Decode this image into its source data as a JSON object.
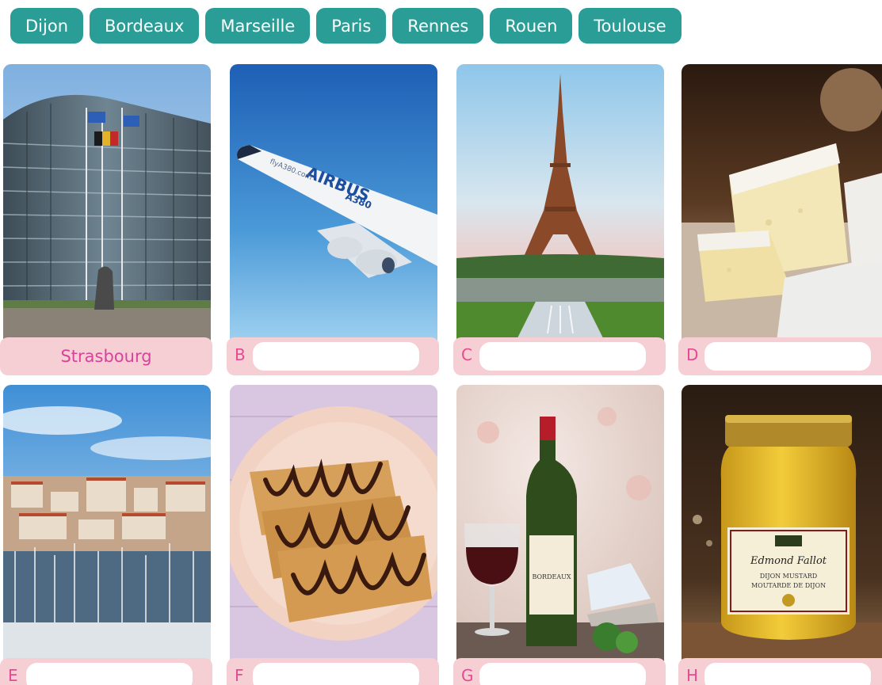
{
  "word_bank": [
    "Dijon",
    "Bordeaux",
    "Marseille",
    "Paris",
    "Rennes",
    "Rouen",
    "Toulouse"
  ],
  "cards": [
    {
      "letter": "",
      "answer": "Strasbourg"
    },
    {
      "letter": "B",
      "answer": ""
    },
    {
      "letter": "C",
      "answer": ""
    },
    {
      "letter": "D",
      "answer": ""
    },
    {
      "letter": "E",
      "answer": ""
    },
    {
      "letter": "F",
      "answer": ""
    },
    {
      "letter": "G",
      "answer": ""
    },
    {
      "letter": "H",
      "answer": ""
    }
  ],
  "photo_text": {
    "airbus": "AIRBUS",
    "a380": "A380",
    "fly": "flyA380.com",
    "jar_brand": "Edmond Fallot",
    "jar_line1": "DIJON MUSTARD",
    "jar_line2": "MOUTARDE DE DIJON",
    "wine_label": "BORDEAUX"
  }
}
